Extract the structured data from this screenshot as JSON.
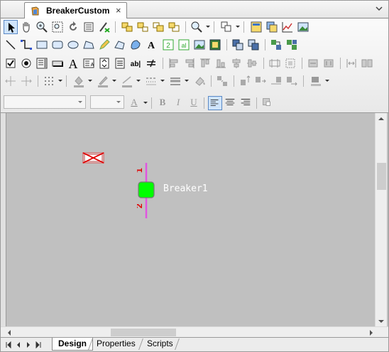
{
  "document_tab": {
    "title": "BreakerCustom",
    "close_glyph": "×"
  },
  "canvas": {
    "breaker_label": "Breaker1",
    "terminal_top": "1",
    "terminal_bottom": "2",
    "breaker_fill": "#00ff00",
    "lead_color": "#e055e0",
    "terminal_color": "#e00000",
    "background": "#c0c0c0"
  },
  "format_bar": {
    "bold": "B",
    "italic": "I",
    "underline": "U",
    "font_color_letter": "A"
  },
  "bottom_tabs": [
    {
      "label": "Design",
      "active": true
    },
    {
      "label": "Properties",
      "active": false
    },
    {
      "label": "Scripts",
      "active": false
    }
  ],
  "toolbar_icons": {
    "row1": [
      "pointer-icon",
      "pan-hand-icon",
      "zoom-in-icon",
      "zoom-fit-icon",
      "refresh-icon",
      "list-icon",
      "validate-icon",
      "group-icon",
      "ungroup-icon",
      "bring-front-icon",
      "send-back-icon",
      "search-icon",
      "arrange-icon",
      "properties-icon",
      "layers-icon",
      "chart-icon",
      "image-icon"
    ],
    "row2": [
      "line-icon",
      "connector-icon",
      "rectangle-icon",
      "rounded-rect-icon",
      "ellipse-icon",
      "polygon-icon",
      "pencil-icon",
      "freeform-icon",
      "fill-shape-icon",
      "text-icon",
      "value-box-icon",
      "variable-icon",
      "picture-icon",
      "symbol-icon",
      "group-box-icon",
      "layout-a-icon",
      "layout-b-icon",
      "link-icon"
    ],
    "row3": [
      "checkbox-icon",
      "radio-icon",
      "listbox-icon",
      "button-icon",
      "label-icon",
      "text-box-icon",
      "spinner-icon",
      "scrollbox-icon",
      "textfield-icon",
      "equals-icon",
      "align-left-icon",
      "align-center-icon",
      "align-right-icon",
      "align-top-icon",
      "align-middle-icon",
      "align-bottom-icon",
      "distribute-icon",
      "distribute-v-icon",
      "same-size-icon",
      "same-width-icon",
      "ruler-icon",
      "flip-icon"
    ],
    "row4": [
      "move-left-icon",
      "move-right-icon",
      "grid-icon",
      "fill-color-icon",
      "line-color-icon",
      "line-weight-icon",
      "line-style-icon",
      "line-end-icon",
      "paint-icon",
      "resize-icon",
      "rotate-icon",
      "bring-up-icon",
      "send-down-icon",
      "shadow-icon"
    ]
  }
}
